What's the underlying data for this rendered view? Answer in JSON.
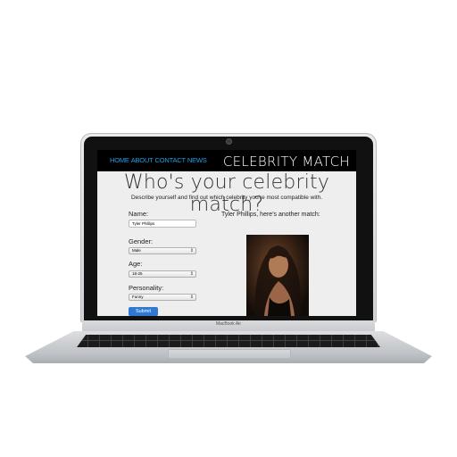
{
  "device": {
    "label": "MacBook Air"
  },
  "site": {
    "nav": [
      "HOME",
      "ABOUT",
      "CONTACT",
      "NEWS"
    ],
    "logo": "CELEBRITY MATCH",
    "headline": "Who's your celebrity match?",
    "subheadline": "Describe yourself and find out which celebrity you're most compatible with."
  },
  "form": {
    "name_label": "Name:",
    "name_value": "Tyler Phillips",
    "gender_label": "Gender:",
    "gender_value": "Male",
    "age_label": "Age:",
    "age_value": "18-25",
    "personality_label": "Personality:",
    "personality_value": "Funny",
    "submit_label": "Submit"
  },
  "result": {
    "message": "Tyler Phillips, here's another match:"
  },
  "colors": {
    "nav": "#1fa0e8",
    "header_bg": "#000000",
    "submit": "#2f79d3"
  }
}
